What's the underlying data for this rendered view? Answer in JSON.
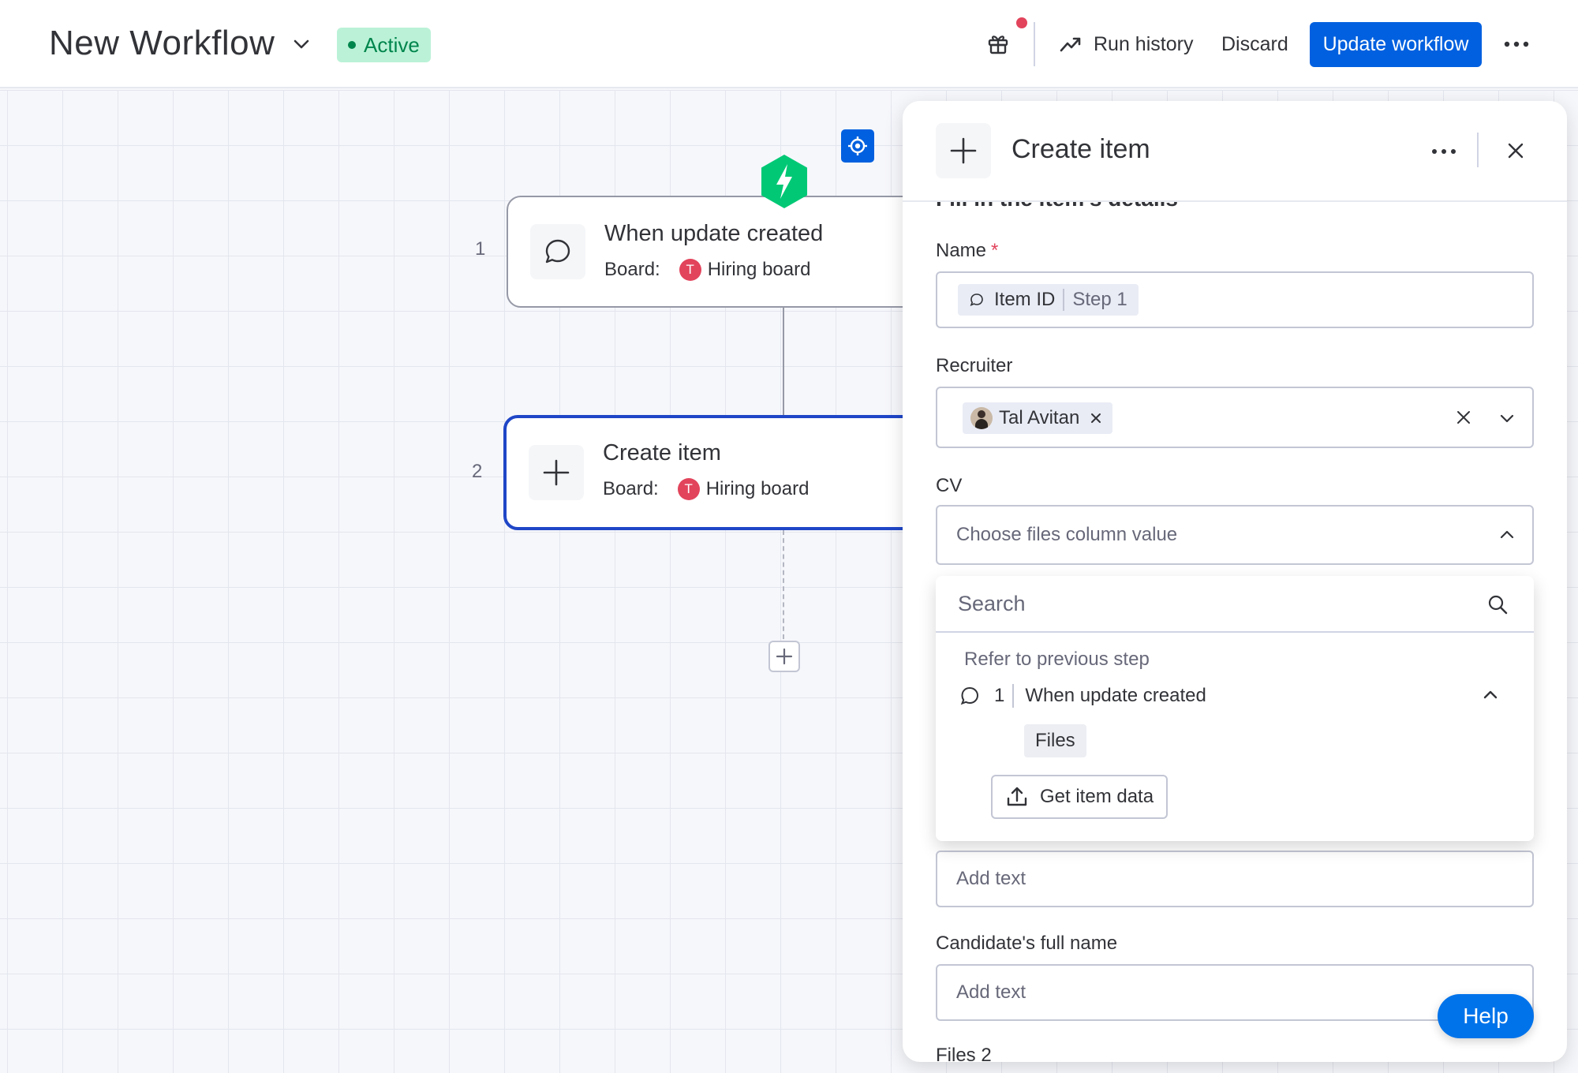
{
  "header": {
    "workflow_title": "New Workflow",
    "status_label": "Active",
    "run_history_label": "Run history",
    "discard_label": "Discard",
    "update_label": "Update workflow",
    "colors": {
      "primary": "#0060df",
      "status_bg": "#bbf2d7",
      "status_text": "#00854d",
      "notification": "#e2445c"
    }
  },
  "canvas": {
    "steps": [
      {
        "number": "1",
        "title": "When update created",
        "board_label": "Board:",
        "board_avatar": "T",
        "board_name": "Hiring board",
        "icon": "speech-bubble-icon"
      },
      {
        "number": "2",
        "title": "Create item",
        "board_label": "Board:",
        "board_avatar": "T",
        "board_name": "Hiring board",
        "icon": "plus-icon"
      }
    ]
  },
  "panel": {
    "title": "Create item",
    "section_heading": "Fill in the item's details",
    "name_field": {
      "label": "Name",
      "required": "*",
      "chip_label": "Item ID",
      "chip_step": "Step 1"
    },
    "recruiter_field": {
      "label": "Recruiter",
      "person": "Tal Avitan"
    },
    "cv_field": {
      "label": "CV",
      "placeholder": "Choose files column value"
    },
    "dropdown": {
      "search_placeholder": "Search",
      "group_label": "Refer to previous step",
      "step_number": "1",
      "step_title": "When update created",
      "option": "Files",
      "get_item_label": "Get item data"
    },
    "text_field_placeholder": "Add text",
    "candidate_field": {
      "label": "Candidate's full name",
      "placeholder": "Add text"
    },
    "files2_label": "Files 2"
  },
  "help_label": "Help"
}
